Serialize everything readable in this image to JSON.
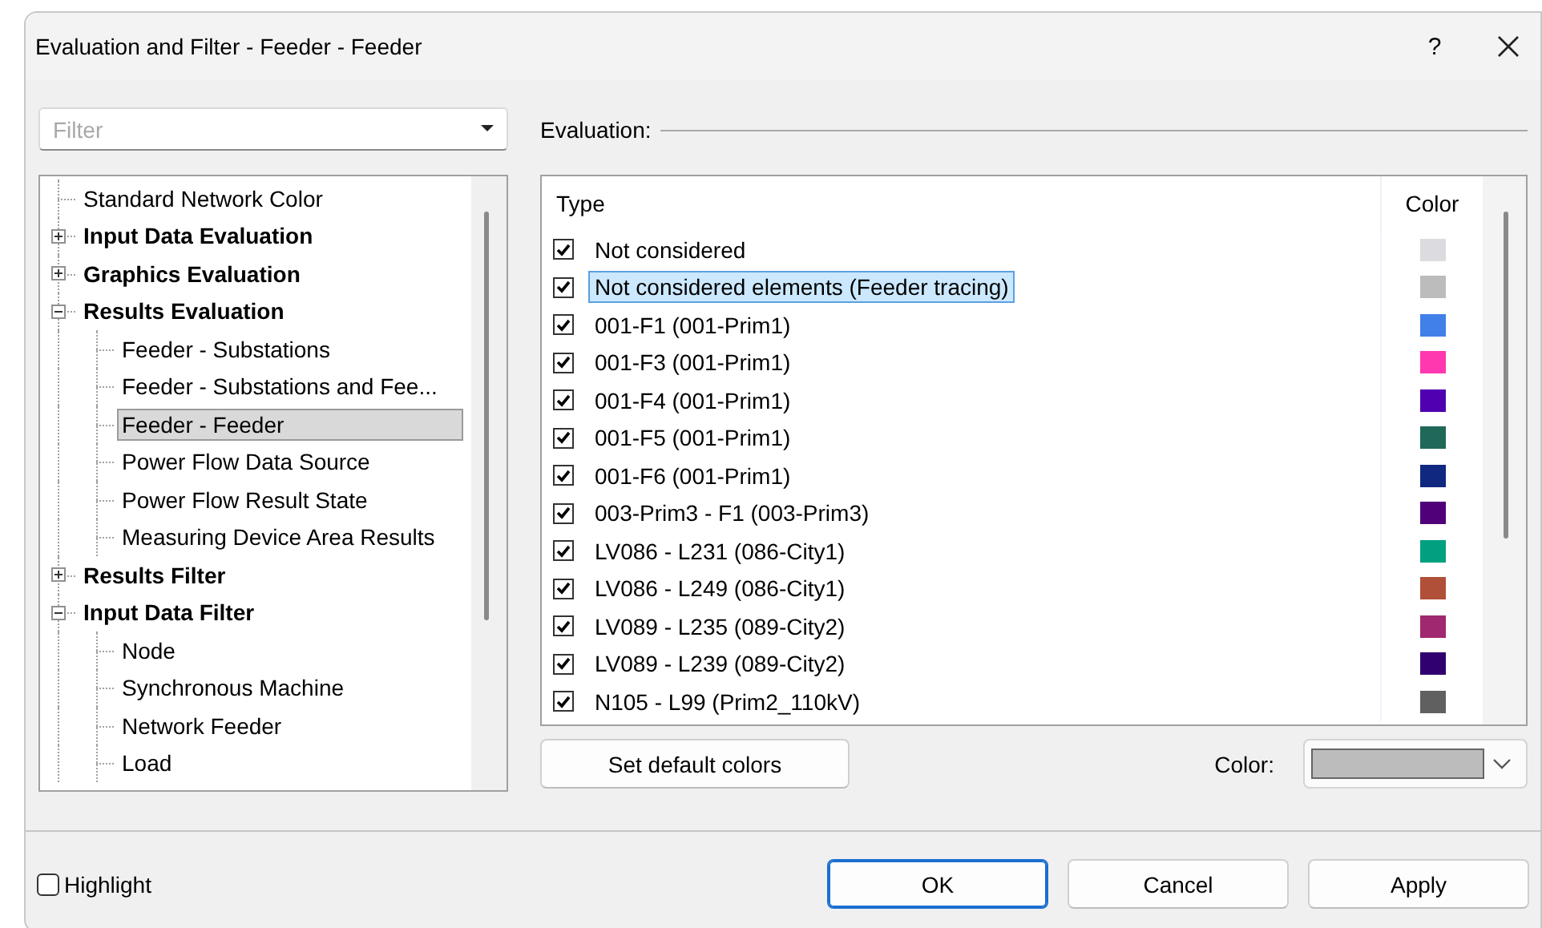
{
  "window": {
    "title": "Evaluation and Filter - Feeder - Feeder",
    "help": "?"
  },
  "filter": {
    "placeholder": "Filter"
  },
  "tree": [
    {
      "label": "Standard Network Color",
      "selected": false
    },
    {
      "label": "Input Data Evaluation",
      "selected": false,
      "expanded": false
    },
    {
      "label": "Graphics Evaluation",
      "selected": false,
      "expanded": false
    },
    {
      "label": "Results Evaluation",
      "selected": false,
      "expanded": true,
      "children": [
        {
          "label": "Feeder - Substations",
          "selected": false
        },
        {
          "label": "Feeder - Substations and Fee...",
          "selected": false
        },
        {
          "label": "Feeder - Feeder",
          "selected": true
        },
        {
          "label": "Power Flow Data Source",
          "selected": false
        },
        {
          "label": "Power Flow Result State",
          "selected": false
        },
        {
          "label": "Measuring Device Area Results",
          "selected": false
        }
      ]
    },
    {
      "label": "Results Filter",
      "selected": false,
      "expanded": false
    },
    {
      "label": "Input Data Filter",
      "selected": false,
      "expanded": true,
      "children": [
        {
          "label": "Node",
          "selected": false
        },
        {
          "label": "Synchronous Machine",
          "selected": false
        },
        {
          "label": "Network Feeder",
          "selected": false
        },
        {
          "label": "Load",
          "selected": false
        }
      ]
    }
  ],
  "evaluation": {
    "title": "Evaluation:",
    "columns": [
      "Type",
      "Color"
    ],
    "rows": [
      {
        "label": "Not considered",
        "checked": true,
        "selected": false,
        "color": "#dcdce0"
      },
      {
        "label": "Not considered elements (Feeder tracing)",
        "checked": true,
        "selected": true,
        "color": "#bcbcbc"
      },
      {
        "label": "001-F1 (001-Prim1)",
        "checked": true,
        "selected": false,
        "color": "#4080e8"
      },
      {
        "label": "001-F3 (001-Prim1)",
        "checked": true,
        "selected": false,
        "color": "#ff38b0"
      },
      {
        "label": "001-F4 (001-Prim1)",
        "checked": true,
        "selected": false,
        "color": "#5000b0"
      },
      {
        "label": "001-F5 (001-Prim1)",
        "checked": true,
        "selected": false,
        "color": "#206858"
      },
      {
        "label": "001-F6 (001-Prim1)",
        "checked": true,
        "selected": false,
        "color": "#102880"
      },
      {
        "label": "003-Prim3 - F1 (003-Prim3)",
        "checked": true,
        "selected": false,
        "color": "#500078"
      },
      {
        "label": "LV086 - L231 (086-City1)",
        "checked": true,
        "selected": false,
        "color": "#00a080"
      },
      {
        "label": "LV086 - L249 (086-City1)",
        "checked": true,
        "selected": false,
        "color": "#b05038"
      },
      {
        "label": "LV089 - L235 (089-City2)",
        "checked": true,
        "selected": false,
        "color": "#a02870"
      },
      {
        "label": "LV089 - L239 (089-City2)",
        "checked": true,
        "selected": false,
        "color": "#300070"
      },
      {
        "label": "N105 - L99 (Prim2_110kV)",
        "checked": true,
        "selected": false,
        "color": "#606060"
      }
    ],
    "default_button": "Set default colors",
    "color_label": "Color:",
    "color": "#bcbcbc"
  },
  "highlight": {
    "label": "Highlight",
    "checked": false
  },
  "buttons": [
    {
      "label": "OK",
      "default": true
    },
    {
      "label": "Cancel",
      "default": false
    },
    {
      "label": "Apply",
      "default": false
    }
  ]
}
